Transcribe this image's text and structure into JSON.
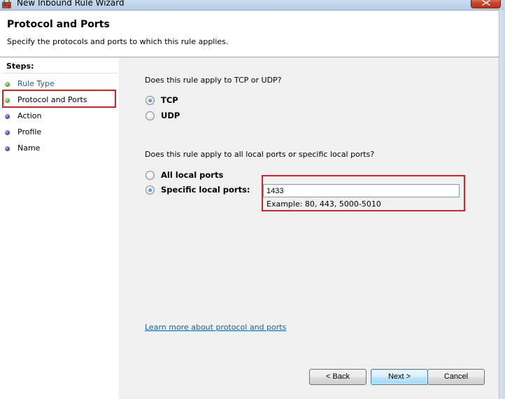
{
  "window": {
    "title": "New Inbound Rule Wizard",
    "accent_color": "#d6202b"
  },
  "header": {
    "title": "Protocol and Ports",
    "subtitle": "Specify the protocols and ports to which this rule applies."
  },
  "steps": {
    "heading": "Steps:",
    "items": [
      {
        "label": "Rule Type",
        "status": "completed",
        "dot_color": "#3f9d16"
      },
      {
        "label": "Protocol and Ports",
        "status": "current",
        "dot_color": "#3f9d16"
      },
      {
        "label": "Action",
        "status": "pending",
        "dot_color": "#2c3bb0"
      },
      {
        "label": "Profile",
        "status": "pending",
        "dot_color": "#2c3bb0"
      },
      {
        "label": "Name",
        "status": "pending",
        "dot_color": "#2c3bb0"
      }
    ]
  },
  "protocol": {
    "question": "Does this rule apply to TCP or UDP?",
    "options": [
      {
        "label": "TCP",
        "selected": true
      },
      {
        "label": "UDP",
        "selected": false
      }
    ]
  },
  "ports": {
    "question": "Does this rule apply to all local ports or specific local ports?",
    "options": [
      {
        "label": "All local ports",
        "selected": false
      },
      {
        "label": "Specific local ports:",
        "selected": true
      }
    ],
    "value": "1433",
    "example": "Example: 80, 443, 5000-5010"
  },
  "learn_more": "Learn more about protocol and ports",
  "buttons": {
    "back": "< Back",
    "next": "Next >",
    "cancel": "Cancel"
  }
}
